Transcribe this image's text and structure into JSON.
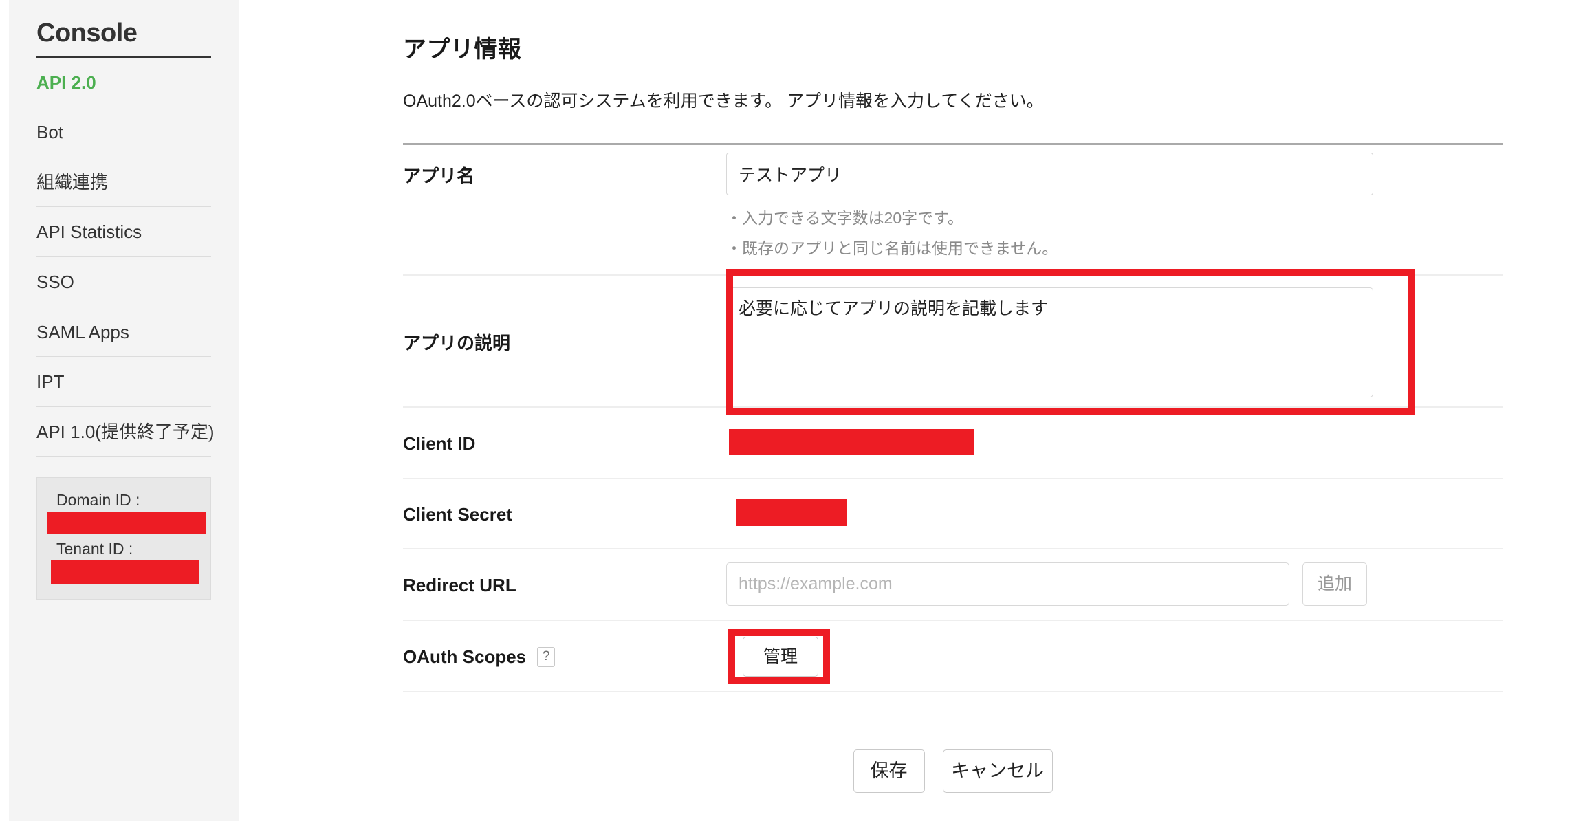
{
  "sidebar": {
    "title": "Console",
    "items": [
      {
        "label": "API 2.0",
        "active": true
      },
      {
        "label": "Bot",
        "active": false
      },
      {
        "label": "組織連携",
        "active": false
      },
      {
        "label": "API Statistics",
        "active": false
      },
      {
        "label": "SSO",
        "active": false
      },
      {
        "label": "SAML Apps",
        "active": false
      },
      {
        "label": "IPT",
        "active": false
      },
      {
        "label": "API 1.0(提供終了予定)",
        "active": false
      }
    ],
    "id_box": {
      "domain_label": "Domain ID :",
      "domain_value": "",
      "tenant_label": "Tenant ID :",
      "tenant_value": ""
    }
  },
  "main": {
    "title": "アプリ情報",
    "description": "OAuth2.0ベースの認可システムを利用できます。 アプリ情報を入力してください。",
    "fields": {
      "app_name": {
        "label": "アプリ名",
        "value": "テストアプリ",
        "placeholder": "",
        "hints": [
          "・入力できる文字数は20字です。",
          "・既存のアプリと同じ名前は使用できません。"
        ]
      },
      "app_description": {
        "label": "アプリの説明",
        "value": "必要に応じてアプリの説明を記載します",
        "placeholder": ""
      },
      "client_id": {
        "label": "Client ID",
        "value": ""
      },
      "client_secret": {
        "label": "Client Secret",
        "value": ""
      },
      "redirect_url": {
        "label": "Redirect URL",
        "value": "",
        "placeholder": "https://example.com",
        "add_label": "追加"
      },
      "oauth_scopes": {
        "label": "OAuth Scopes",
        "help_glyph": "?",
        "manage_label": "管理"
      }
    },
    "actions": {
      "save_label": "保存",
      "cancel_label": "キャンセル"
    }
  },
  "colors": {
    "accent_green": "#4caf50",
    "annotation_red": "#ed1c24",
    "sidebar_bg": "#f4f4f4",
    "text": "#1a1a1a"
  }
}
